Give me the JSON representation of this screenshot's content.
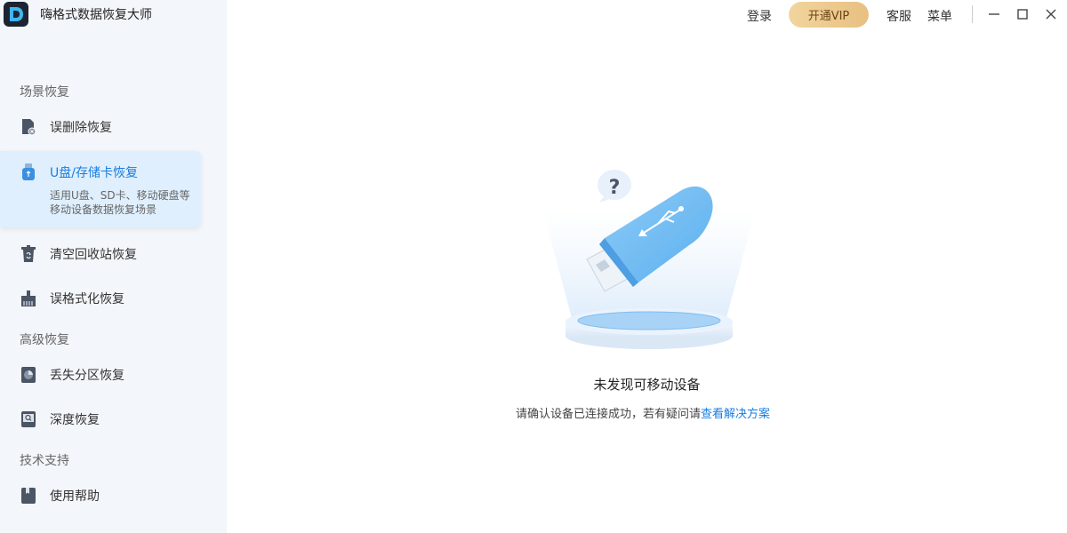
{
  "app": {
    "title": "嗨格式数据恢复大师"
  },
  "topbar": {
    "login": "登录",
    "vip": "开通VIP",
    "service": "客服",
    "menu": "菜单"
  },
  "sidebar": {
    "sections": [
      {
        "label": "场景恢复",
        "items": [
          {
            "label": "误删除恢复",
            "icon": "file-delete-icon"
          },
          {
            "label": "U盘/存储卡恢复",
            "icon": "usb-icon",
            "active": true,
            "desc1": "适用U盘、SD卡、移动硬盘等",
            "desc2": "移动设备数据恢复场景"
          },
          {
            "label": "清空回收站恢复",
            "icon": "recycle-bin-icon"
          },
          {
            "label": "误格式化恢复",
            "icon": "format-brush-icon"
          }
        ]
      },
      {
        "label": "高级恢复",
        "items": [
          {
            "label": "丢失分区恢复",
            "icon": "partition-icon"
          },
          {
            "label": "深度恢复",
            "icon": "deep-scan-icon"
          }
        ]
      },
      {
        "label": "技术支持",
        "items": [
          {
            "label": "使用帮助",
            "icon": "help-book-icon"
          }
        ]
      }
    ]
  },
  "main": {
    "empty_title": "未发现可移动设备",
    "empty_desc": "请确认设备已连接成功，若有疑问请",
    "empty_link": "查看解决方案"
  },
  "colors": {
    "accent": "#1a7de0",
    "sidebar_bg": "#f3f6fa",
    "active_bg": "#dfeffd",
    "vip_gold": "#e8c081"
  }
}
